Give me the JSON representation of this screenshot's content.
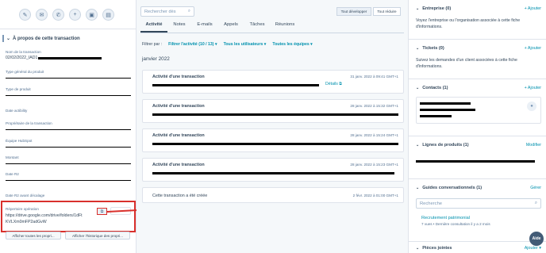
{
  "left": {
    "action_icons": [
      "edit-icon",
      "email-icon",
      "phone-icon",
      "add-icon",
      "calendar-icon",
      "task-icon"
    ],
    "action_glyphs": [
      "✎",
      "✉",
      "✆",
      "+",
      "▣",
      "▤"
    ],
    "section_title": "À propos de cette transaction",
    "fields": [
      {
        "label": "Nom de la transaction",
        "value": "02/02/2022_IAD1"
      },
      {
        "label": "Type général du produit",
        "value": ""
      },
      {
        "label": "Type de produit",
        "value": ""
      },
      {
        "label": "Date actibility",
        "value": ""
      },
      {
        "label": "Propriétaire de la transaction",
        "value": ""
      },
      {
        "label": "Équipe HubSpot",
        "value": ""
      },
      {
        "label": "Montant",
        "value": ""
      },
      {
        "label": "Date R2",
        "value": ""
      },
      {
        "label": "Date R2 avant décalage",
        "value": ""
      }
    ],
    "repertoire": {
      "label": "Répertoire opération",
      "value_line1": "https://drive.google.com/drive/folders/1dFt",
      "value_line2": "KVLXm0mFP2adGvW"
    },
    "buttons": {
      "show_all": "Afficher toutes les propri...",
      "show_history": "Afficher l'historique des propri..."
    }
  },
  "annotations": {
    "one": "1",
    "two": "2"
  },
  "middle": {
    "search_placeholder": "Rechercher dès",
    "toggle_expand": "Tout développer",
    "toggle_collapse": "Tout réduire",
    "tabs": [
      "Activité",
      "Notes",
      "E-mails",
      "Appels",
      "Tâches",
      "Réunions"
    ],
    "filter_label": "Filtrer par :",
    "filter_activity": "Filtrer l'activité (10 / 13) ▾",
    "filter_users": "Tous les utilisateurs ▾",
    "filter_teams": "Toutes les équipes ▾",
    "month": "janvier 2022",
    "cards": [
      {
        "title": "Activité d'une transaction",
        "date": "31 janv. 2022 à 09:41 GMT+1",
        "details": "Détails ⧉"
      },
      {
        "title": "Activité d'une transaction",
        "date": "28 janv. 2022 à 15:32 GMT+1",
        "details": ""
      },
      {
        "title": "Activité d'une transaction",
        "date": "28 janv. 2022 à 15:24 GMT+1",
        "details": ""
      },
      {
        "title": "Activité d'une transaction",
        "date": "28 janv. 2022 à 15:23 GMT+1",
        "details": ""
      }
    ],
    "created": {
      "text": "Cette transaction a été créée",
      "date": "2 févr. 2022 à 01:00 GMT+1"
    }
  },
  "right": {
    "entreprise": {
      "title": "Entreprise (0)",
      "action": "+ Ajouter",
      "text": "Voyez l'entreprise ou l'organisation associée à cette fiche d'informations."
    },
    "tickets": {
      "title": "Tickets (0)",
      "action": "+ Ajouter",
      "text": "Suivez les demandes d'un client associées à cette fiche d'informations."
    },
    "contacts": {
      "title": "Contacts (1)",
      "action": "+ Ajouter"
    },
    "lignes": {
      "title": "Lignes de produits (1)",
      "action": "Modifier"
    },
    "guides": {
      "title": "Guides conversationnels (1)",
      "action": "Gérer",
      "search_placeholder": "Recherche",
      "link": "Recrutement patrimonial",
      "meta": "7 vues • Dernière consultation il y a 2 mois"
    },
    "pieces": {
      "title": "Pièces jointes",
      "action": "Ajouter ▾"
    },
    "help_button": "Aide"
  },
  "colors": {
    "accent": "#0091ae",
    "annotation": "#d9302c",
    "text": "#33475b"
  }
}
